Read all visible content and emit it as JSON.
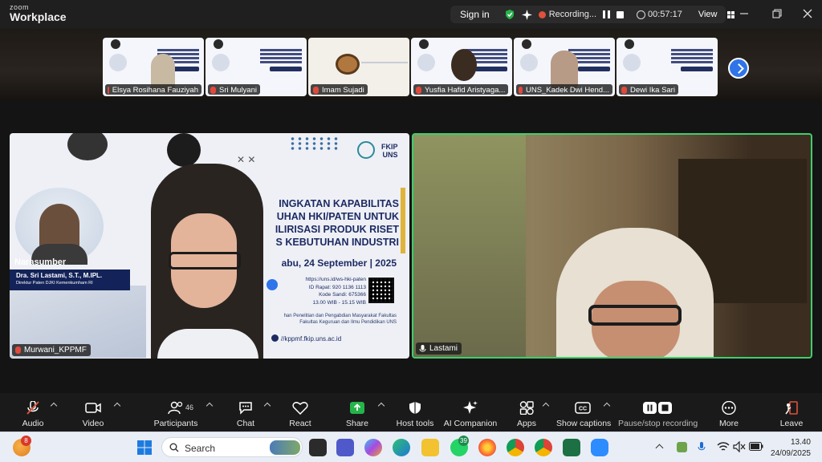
{
  "app": {
    "logo_small": "zoom",
    "logo_big": "Workplace"
  },
  "meeting_bar": {
    "sign_in": "Sign in",
    "recording_label": "Recording...",
    "timer": "00:57:17",
    "view_label": "View"
  },
  "gallery": [
    {
      "name": "Elsya Rosihana Fauziyah"
    },
    {
      "name": "Sri Mulyani"
    },
    {
      "name": "Imam Sujadi"
    },
    {
      "name": "Yusfia Hafid Aristyaga..."
    },
    {
      "name": "UNS_Kadek Dwi Hend..."
    },
    {
      "name": "Dewi Ika Sari"
    }
  ],
  "slide": {
    "title": "INGKATAN KAPABILITAS\nUHAN HKI/PATEN UNTUK\nILIRISASI PRODUK RISET\nS KEBUTUHAN INDUSTRI",
    "date": "abu, 24 September | 2025",
    "info": "https://uns.id/ws-hki-paten\nID Rapat: 920 1136 1113\nKode Sandi: 675366\n13.00 WIB - 15.15 WIB",
    "footer": "han Penelitian dan Pengabdian Masyarakat Fakultas\nFakultas Keguruan dan Ilmu Pendidikan UNS",
    "url": "//kppmf.fkip.uns.ac.id",
    "org": "FKIP\nUNS",
    "narasumber_label": "Narasumber",
    "speaker_name": "Dra. Sri Lastami, S.T., M.IPL.",
    "speaker_title": "Direktur Paten DJKI Kemenkumham RI"
  },
  "tiles": {
    "left_name": "Murwani_KPPMF",
    "right_name": "Lastami"
  },
  "toolbar": {
    "audio": "Audio",
    "video": "Video",
    "participants": "Participants",
    "participants_count": "46",
    "chat": "Chat",
    "react": "React",
    "share": "Share",
    "host_tools": "Host tools",
    "ai_companion": "AI Companion",
    "apps": "Apps",
    "captions": "Show captions",
    "recording": "Pause/stop recording",
    "more": "More",
    "leave": "Leave"
  },
  "taskbar": {
    "weather_badge": "8",
    "search_placeholder": "Search",
    "whatsapp_badge": "39",
    "time": "13.40",
    "date": "24/09/2025"
  },
  "colors": {
    "accent_blue": "#2f74e9",
    "active_speaker": "#3fce6c",
    "record_red": "#e0513c",
    "share_green": "#25b34a"
  }
}
